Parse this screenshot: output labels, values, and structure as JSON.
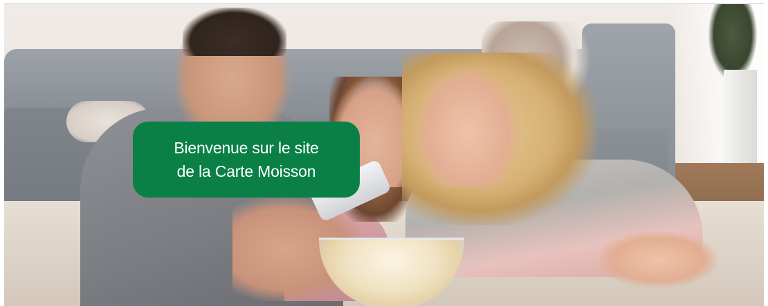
{
  "hero": {
    "welcome_line_1": "Bienvenue sur le site",
    "welcome_line_2": "de la Carte Moisson",
    "welcome_bg_color": "#0a8046",
    "welcome_text_color": "#ffffff"
  }
}
